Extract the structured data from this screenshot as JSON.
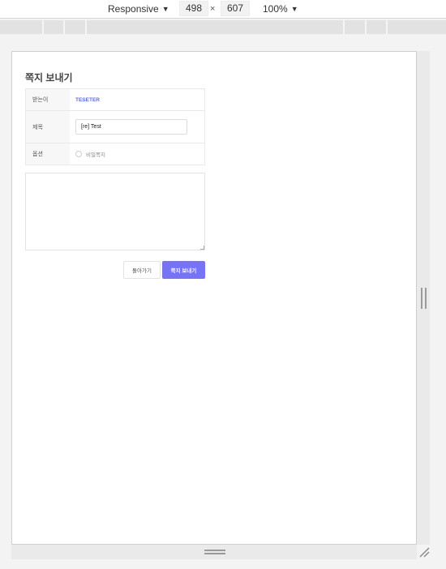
{
  "devtools": {
    "device": "Responsive",
    "width": "498",
    "height": "607",
    "times": "×",
    "zoom": "100%"
  },
  "page": {
    "title": "쪽지 보내기",
    "recipient_label": "받는이",
    "recipient_value": "TESETER",
    "subject_label": "제목",
    "subject_value": "[re] Test",
    "option_label": "옵션",
    "option_secret_label": "비밀쪽지",
    "message_value": "",
    "back_button": "돌아가기",
    "send_button": "쪽지 보내기"
  },
  "colors": {
    "accent": "#7674f5",
    "recipient": "#5b6ee6"
  }
}
